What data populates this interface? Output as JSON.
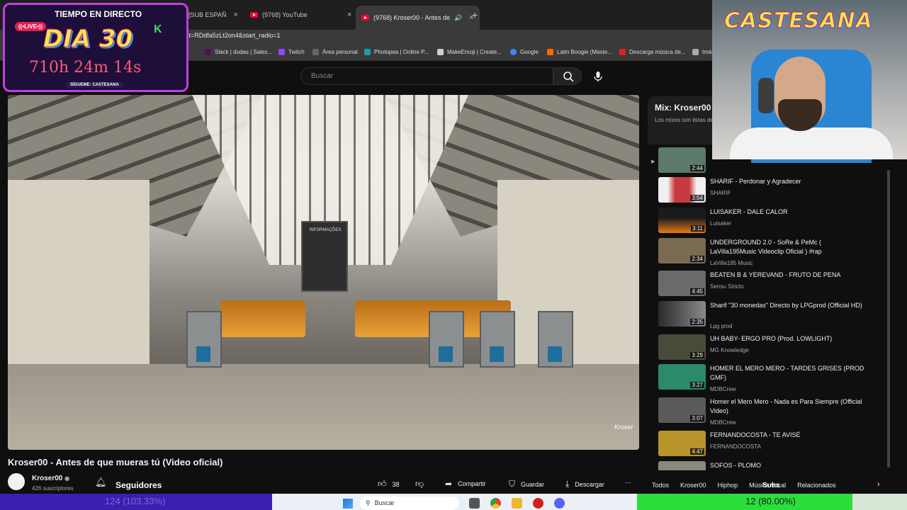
{
  "browser": {
    "tabs": [
      {
        "label": "[SUB ESPAÑ",
        "close": "×"
      },
      {
        "label": "(9768) YouTube",
        "close": "×"
      },
      {
        "label": "(9768) Kroser00 - Antes de",
        "close": "×",
        "active": true
      }
    ],
    "new_tab": "+",
    "url": "st=RDdfa5zLt2on4&start_radio=1",
    "bookmarks": [
      {
        "label": "Slack | dudas | Sales...",
        "color": "#4a154b"
      },
      {
        "label": "Twitch",
        "color": "#9146ff"
      },
      {
        "label": "Área personal",
        "color": "#666666"
      },
      {
        "label": "Photopea | Online P...",
        "color": "#19a0a0"
      },
      {
        "label": "MakeEmoji | Create...",
        "color": "#d0d0d0"
      },
      {
        "label": "Google",
        "color": "#4285f4"
      },
      {
        "label": "Latin Boogie (Maste...",
        "color": "#ff6a00"
      },
      {
        "label": "Descarga música de...",
        "color": "#e02020"
      },
      {
        "label": "Imá",
        "color": "#aaaaaa"
      }
    ]
  },
  "youtube": {
    "search_placeholder": "Buscar",
    "video": {
      "board_text": "INFORMAÇÕES",
      "watermark": "Kroser",
      "title": "Kroser00 - Antes de que mueras tú (Video oficial)",
      "channel": "Kroser00",
      "subscribers": "426 suscriptores",
      "follow_label": "Seguidores",
      "likes": "38",
      "share": "Compartir",
      "save": "Guardar",
      "download": "Descargar",
      "more": "⋯"
    },
    "mix": {
      "title": "Mix: Kroser00",
      "subtitle": "Los mixes son listas de"
    },
    "playlist": [
      {
        "title": "",
        "channel": "",
        "duration": "2:44",
        "color": "#5b7a6a"
      },
      {
        "title": "SHARIF - Perdonar y Agradecer",
        "channel": "SHARIF",
        "duration": "3:54",
        "color": "#c93a40"
      },
      {
        "title": "LUISAKER - DALE CALOR",
        "channel": "Luisaker",
        "duration": "3:11",
        "color": "#e87a18"
      },
      {
        "title": "UNDERGROUND 2.0 - SoRe & PeMc ( LaVilla195Music Videoclip Oficial ) #rap",
        "channel": "LaVilla195 Music",
        "duration": "2:34",
        "color": "#7a6a52"
      },
      {
        "title": "BEATEN B & YEREVAND - FRUTO DE PENA",
        "channel": "Sensu Stricto",
        "duration": "4:45",
        "color": "#6a6a6a"
      },
      {
        "title": "Sharif \"30 monedas\" Directo by LPGprod (Official HD)",
        "channel": "Lpg prod",
        "duration": "2:35",
        "color": "#3a3a3a"
      },
      {
        "title": "UH BABY- ERGO PRO (Prod. LOWLIGHT)",
        "channel": "MG Knowledge",
        "duration": "3:29",
        "color": "#4a4a3a"
      },
      {
        "title": "HOMER EL MERO MERO - TARDES GRISES (PROD GMF)",
        "channel": "MDBCrew",
        "duration": "3:27",
        "color": "#2a8a6a"
      },
      {
        "title": "Homer el Mero Mero - Nada es Para Siempre (Official Video)",
        "channel": "MDBCrew",
        "duration": "3:07",
        "color": "#5a5a5a"
      },
      {
        "title": "FERNANDOCOSTA - TE AVISÉ",
        "channel": "FERNANDOCOSTA",
        "duration": "4:47",
        "color": "#b8952a"
      },
      {
        "title": "SOFOS - PLOMO",
        "channel": "",
        "duration": "",
        "color": "#8a8a7a"
      }
    ],
    "chips": [
      "Todos",
      "Kroser00",
      "Hiphop",
      "Música vocal",
      "Relacionados"
    ],
    "chips_next": "›"
  },
  "overlay": {
    "header": "TIEMPO EN DIRECTO",
    "live": "((•LIVE•))",
    "day": "DIA 30",
    "k": "K",
    "time": "710h 24m 14s",
    "follow": "SÍGUEME: CASTESANA",
    "cam_logo": "CASTESANA",
    "subs_overlay": "Subs"
  },
  "bottom": {
    "left_bar_text": "124 (103.33%)",
    "left_bar_fraction": 1.0333,
    "search_label": "Buscar",
    "right_bar_text": "12 (80.00%)",
    "right_bar_fraction": 0.8,
    "taskbar_apps": [
      {
        "name": "file-explorer-icon",
        "color": "#555555"
      },
      {
        "name": "chrome-icon",
        "color": "#e04040"
      },
      {
        "name": "folder-icon",
        "color": "#e8b830"
      },
      {
        "name": "record-icon",
        "color": "#d02020"
      },
      {
        "name": "discord-icon",
        "color": "#5865f2"
      }
    ]
  }
}
